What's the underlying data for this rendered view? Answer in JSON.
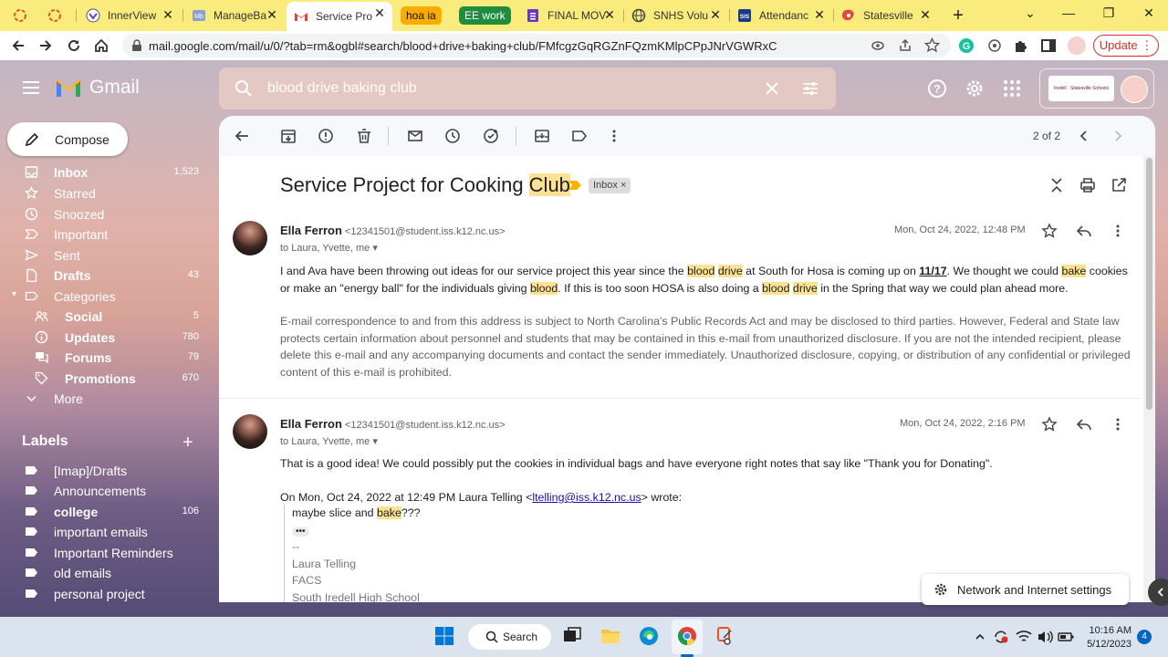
{
  "browser": {
    "tabs": [
      {
        "label": "",
        "icon": "loading-icon"
      },
      {
        "label": "",
        "icon": "loading-icon"
      },
      {
        "label": "InnerView",
        "icon": "innerview-icon"
      },
      {
        "label": "ManageBa",
        "icon": "managebac-icon"
      },
      {
        "label": "Service Pro",
        "icon": "gmail-icon",
        "active": true
      },
      {
        "label": "hoa ia",
        "group": true,
        "color": "#f9ab00"
      },
      {
        "label": "EE work",
        "group": true,
        "color": "#1e8e3e"
      },
      {
        "label": "FINAL MOV",
        "icon": "forms-icon"
      },
      {
        "label": "SNHS Volu",
        "icon": "globe-icon"
      },
      {
        "label": "Attendanc",
        "icon": "sis-icon"
      },
      {
        "label": "Statesville",
        "icon": "statesville-icon"
      }
    ],
    "url": "mail.google.com/mail/u/0/?tab=rm&ogbl#search/blood+drive+baking+club/FMfcgzGqRGZnFQzmKMlpCPpJNrVGWRxC",
    "update_label": "Update"
  },
  "gmail": {
    "app_name": "Gmail",
    "search_query": "blood drive baking club",
    "account_logo_text": "Iredell · Statesville Schools"
  },
  "sidebar": {
    "compose_label": "Compose",
    "items": [
      {
        "label": "Inbox",
        "count": "1,523",
        "icon": "inbox-icon",
        "bold": true
      },
      {
        "label": "Starred",
        "count": "",
        "icon": "star-icon"
      },
      {
        "label": "Snoozed",
        "count": "",
        "icon": "clock-icon"
      },
      {
        "label": "Important",
        "count": "",
        "icon": "important-icon"
      },
      {
        "label": "Sent",
        "count": "",
        "icon": "send-icon"
      },
      {
        "label": "Drafts",
        "count": "43",
        "icon": "draft-icon",
        "bold": true
      },
      {
        "label": "Categories",
        "count": "",
        "icon": "label-icon"
      },
      {
        "label": "Social",
        "count": "5",
        "icon": "people-icon",
        "sub": true
      },
      {
        "label": "Updates",
        "count": "780",
        "icon": "info-icon",
        "sub": true
      },
      {
        "label": "Forums",
        "count": "79",
        "icon": "forum-icon",
        "sub": true
      },
      {
        "label": "Promotions",
        "count": "670",
        "icon": "tag-icon",
        "sub": true
      },
      {
        "label": "More",
        "count": "",
        "icon": "chevron-down-icon"
      }
    ],
    "labels_title": "Labels",
    "labels": [
      {
        "label": "[Imap]/Drafts",
        "count": ""
      },
      {
        "label": "Announcements",
        "count": ""
      },
      {
        "label": "college",
        "count": "106",
        "bold": true
      },
      {
        "label": "important emails",
        "count": ""
      },
      {
        "label": "Important Reminders",
        "count": ""
      },
      {
        "label": "old emails",
        "count": ""
      },
      {
        "label": "personal project",
        "count": ""
      }
    ]
  },
  "thread": {
    "pager": "2 of 2",
    "subject_pre": "Service Project for Cooking ",
    "subject_hl": "Club",
    "inbox_chip": "Inbox",
    "messages": [
      {
        "sender_name": "Ella Ferron",
        "sender_email": "<12341501@student.iss.k12.nc.us>",
        "to": "to Laura, Yvette, me",
        "date": "Mon, Oct 24, 2022, 12:48 PM",
        "body": [
          {
            "t": "I and Ava have been throwing out ideas for our service project this year since the "
          },
          {
            "t": "blood",
            "hl": true
          },
          {
            "t": " "
          },
          {
            "t": "drive",
            "hl": true
          },
          {
            "t": " at South for Hosa is coming up on "
          },
          {
            "t": "11/17",
            "u": true
          },
          {
            "t": ". We thought we could "
          },
          {
            "t": "bake",
            "hl": true
          },
          {
            "t": " cookies or make an \"energy ball\" for the individuals giving "
          },
          {
            "t": "blood",
            "hl": true
          },
          {
            "t": ". If this is too soon HOSA is also doing a "
          },
          {
            "t": "blood",
            "hl": true
          },
          {
            "t": " "
          },
          {
            "t": "drive",
            "hl": true
          },
          {
            "t": " in the Spring that way we could plan ahead more."
          }
        ],
        "disclaimer": "E-mail correspondence to and from this address is subject to North Carolina's Public Records Act and may be disclosed to third parties. However, Federal and State law protects certain information about personnel and students that may be contained in this e-mail from unauthorized disclosure. If you are not the intended recipient, please delete this e-mail and any accompanying documents and contact the sender immediately. Unauthorized disclosure, copying, or distribution of any confidential or privileged content of this e-mail is prohibited."
      },
      {
        "sender_name": "Ella Ferron",
        "sender_email": "<12341501@student.iss.k12.nc.us>",
        "to": "to Laura, Yvette, me",
        "date": "Mon, Oct 24, 2022, 2:16 PM",
        "body_text": "That is a good idea! We could possibly put the cookies in individual bags and have everyone right notes that say like \"Thank you for Donating\".",
        "quote_header_pre": "On Mon, Oct 24, 2022 at 12:49 PM Laura Telling <",
        "quote_link": "ltelling@iss.k12.nc.us",
        "quote_header_post": "> wrote:",
        "quote_pre": "maybe slice and ",
        "quote_hl": "bake",
        "quote_post": "???",
        "quote_ellipsis": "•••",
        "sig_lines": [
          "--",
          "Laura Telling",
          "FACS",
          "South Iredell High School"
        ]
      }
    ]
  },
  "toast": {
    "text": "Network and Internet settings"
  },
  "taskbar": {
    "search_label": "Search",
    "time": "10:16 AM",
    "date": "5/12/2023",
    "notification_count": "4"
  },
  "colors": {
    "tabstrip": "#f9ec7c",
    "highlight": "#fde293",
    "update_red": "#d93025"
  }
}
